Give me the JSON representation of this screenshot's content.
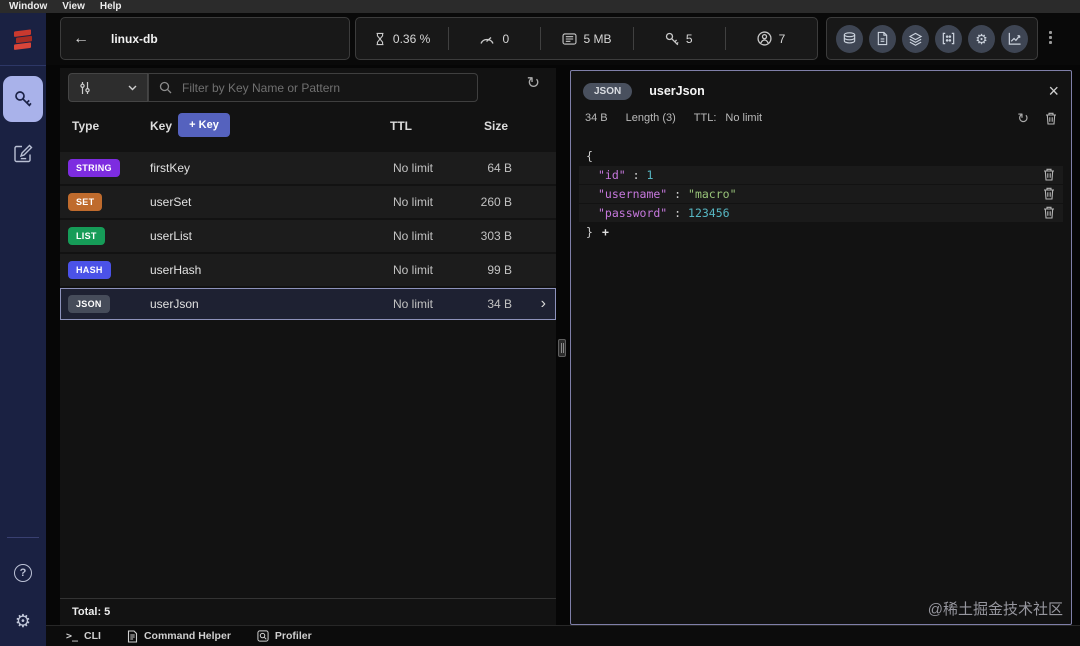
{
  "menu": {
    "items": [
      "Window",
      "View",
      "Help"
    ]
  },
  "header": {
    "db_name": "linux-db",
    "stats": [
      {
        "name": "cpu-usage",
        "value": "0.36 %"
      },
      {
        "name": "commands-per-sec",
        "value": "0"
      },
      {
        "name": "total-memory",
        "value": "5 MB"
      },
      {
        "name": "total-keys",
        "value": "5"
      },
      {
        "name": "connected-clients",
        "value": "7"
      }
    ]
  },
  "browser": {
    "search_placeholder": "Filter by Key Name or Pattern",
    "columns": {
      "type": "Type",
      "key": "Key",
      "ttl": "TTL",
      "size": "Size"
    },
    "add_key_label": "+ Key",
    "rows": [
      {
        "type": "STRING",
        "type_color": "#7d2ce0",
        "key": "firstKey",
        "ttl": "No limit",
        "size": "64 B"
      },
      {
        "type": "SET",
        "type_color": "#bf6b2d",
        "key": "userSet",
        "ttl": "No limit",
        "size": "260 B"
      },
      {
        "type": "LIST",
        "type_color": "#169c58",
        "key": "userList",
        "ttl": "No limit",
        "size": "303 B"
      },
      {
        "type": "HASH",
        "type_color": "#4b52e8",
        "key": "userHash",
        "ttl": "No limit",
        "size": "99 B"
      },
      {
        "type": "JSON",
        "type_color": "#464c5a",
        "key": "userJson",
        "ttl": "No limit",
        "size": "34 B"
      }
    ],
    "total_label": "Total: 5"
  },
  "detail": {
    "type_badge": "JSON",
    "key_name": "userJson",
    "size": "34 B",
    "length_label": "Length (3)",
    "ttl_label": "TTL:",
    "ttl_value": "No limit",
    "json": {
      "open_brace": "{",
      "entries": [
        {
          "key": "\"id\"",
          "sep": " : ",
          "value": "1",
          "value_type": "number"
        },
        {
          "key": "\"username\"",
          "sep": " : ",
          "value": "\"macro\"",
          "value_type": "string"
        },
        {
          "key": "\"password\"",
          "sep": " : ",
          "value": "123456",
          "value_type": "number"
        }
      ],
      "close_brace": "}"
    }
  },
  "bottom_bar": {
    "cli_label": "CLI",
    "command_helper_label": "Command Helper",
    "profiler_label": "Profiler"
  },
  "watermark": "@稀土掘金技术社区",
  "icons": {
    "back": "←",
    "close": "×",
    "chevron_right": "›",
    "refresh": "↻",
    "gear": "⚙",
    "help": "?",
    "plus": "+",
    "terminal": ">_"
  },
  "colors": {
    "sidebar_bg": "#1a2142",
    "sidebar_active": "#a9b2ea",
    "detail_panel_border": "#7f7fa8",
    "add_key_button": "#5562be",
    "json_key": "#c678dd",
    "json_string": "#98c379",
    "json_number": "#56b6c2"
  }
}
